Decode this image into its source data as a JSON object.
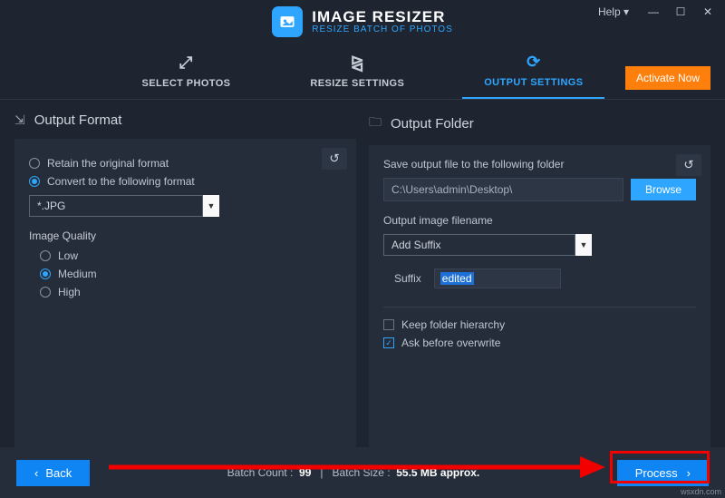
{
  "app": {
    "title": "IMAGE RESIZER",
    "subtitle": "RESIZE BATCH OF PHOTOS"
  },
  "window": {
    "help": "Help ▾"
  },
  "tabs": {
    "select": "SELECT PHOTOS",
    "resize": "RESIZE SETTINGS",
    "output": "OUTPUT SETTINGS"
  },
  "activate": "Activate Now",
  "left": {
    "title": "Output Format",
    "retain": "Retain the original format",
    "convert": "Convert to the following format",
    "format_selected": "*.JPG",
    "quality_label": "Image Quality",
    "low": "Low",
    "medium": "Medium",
    "high": "High"
  },
  "right": {
    "title": "Output Folder",
    "save_label": "Save output file to the following folder",
    "path": "C:\\Users\\admin\\Desktop\\",
    "browse": "Browse",
    "filename_label": "Output image filename",
    "filename_mode": "Add Suffix",
    "suffix_label": "Suffix",
    "suffix_value": "edited",
    "keep_hierarchy": "Keep folder hierarchy",
    "ask_overwrite": "Ask before overwrite"
  },
  "footer": {
    "back": "Back",
    "batch_count_label": "Batch Count :",
    "batch_count": "99",
    "batch_size_label": "Batch Size :",
    "batch_size": "55.5 MB approx.",
    "process": "Process"
  },
  "watermark": "wsxdn.com"
}
